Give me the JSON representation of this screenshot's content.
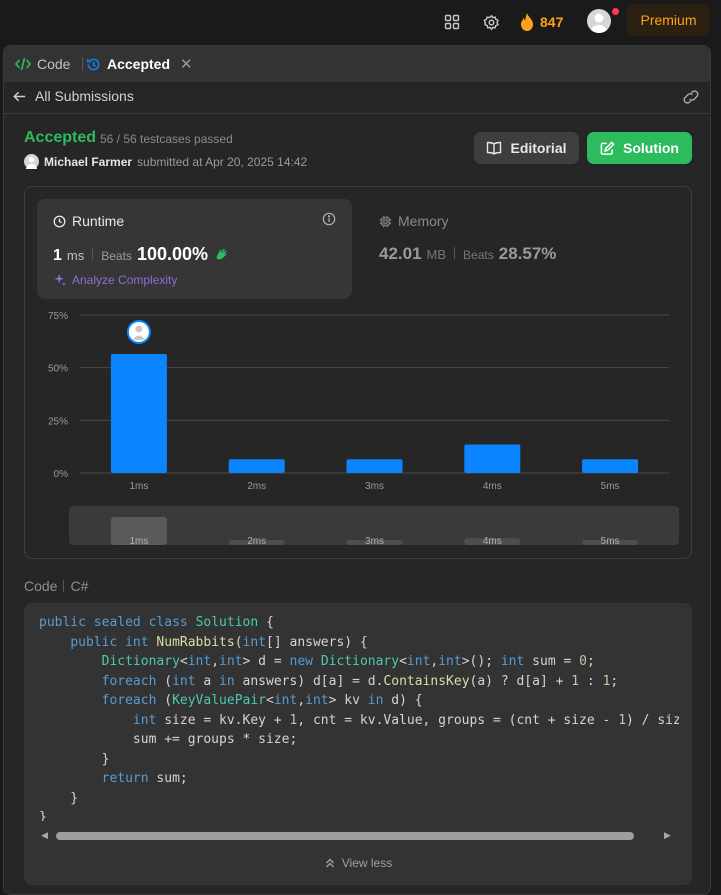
{
  "nav": {
    "streak_count": "847",
    "premium_label": "Premium"
  },
  "tabs": {
    "code_label": "Code",
    "accepted_label": "Accepted"
  },
  "subbar": {
    "back_label": "All Submissions"
  },
  "result": {
    "status": "Accepted",
    "testcases": "56 / 56 testcases passed",
    "user_name": "Michael Farmer",
    "submitted_text": "submitted at Apr 20, 2025 14:42",
    "editorial_label": "Editorial",
    "solution_label": "Solution"
  },
  "runtime": {
    "title": "Runtime",
    "value": "1",
    "unit": "ms",
    "beats_label": "Beats",
    "beats_value": "100.00%",
    "analyze_label": "Analyze Complexity"
  },
  "memory": {
    "title": "Memory",
    "value": "42.01",
    "unit": "MB",
    "beats_label": "Beats",
    "beats_value": "28.57%"
  },
  "chart_data": {
    "type": "bar",
    "categories": [
      "1ms",
      "2ms",
      "3ms",
      "4ms",
      "5ms"
    ],
    "values": [
      56.5,
      6.5,
      6.5,
      13.5,
      6.5
    ],
    "ytick_labels": [
      "0%",
      "25%",
      "50%",
      "75%"
    ],
    "ylim": [
      0,
      75
    ],
    "grid": true,
    "highlight_category": "1ms",
    "bar_color": "#0a84ff"
  },
  "code": {
    "label": "Code",
    "language": "C#",
    "view_less_label": "View less"
  },
  "colors": {
    "accepted_green": "#2cbb5d",
    "premium_orange": "#ffa116",
    "bar_blue": "#0a84ff"
  }
}
